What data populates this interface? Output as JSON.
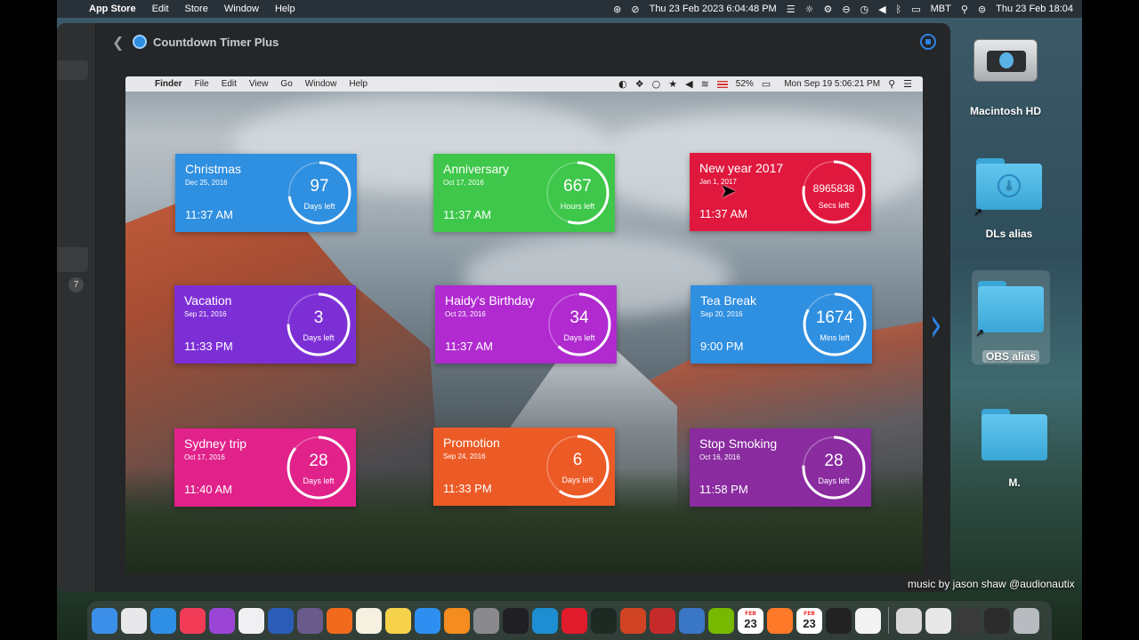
{
  "host_menubar": {
    "apple": "",
    "app": "App Store",
    "menus": [
      "Edit",
      "Store",
      "Window",
      "Help"
    ],
    "datetime": "Thu 23 Feb 2023  6:04:48 PM",
    "keyboard": "MBT",
    "clock": "Thu 23 Feb  18:04",
    "status_icons": [
      "screen-share-icon",
      "accessibility-icon",
      "menu-extra-icon",
      "brightness-icon",
      "shortcut-icon",
      "focus-icon",
      "time-machine-icon",
      "volume-icon",
      "bluetooth-icon",
      "battery-icon",
      "search-icon",
      "control-center-icon"
    ]
  },
  "app": {
    "title": "Countdown Timer Plus",
    "sidebar_badge": "7"
  },
  "inner_menubar": {
    "app": "Finder",
    "menus": [
      "File",
      "Edit",
      "View",
      "Go",
      "Window",
      "Help"
    ],
    "battery": "52%",
    "datetime": "Mon Sep 19  5:06:21 PM"
  },
  "cards": [
    {
      "title": "Christmas",
      "date": "Dec 25, 2016",
      "time": "11:37 AM",
      "value": "97",
      "unit": "Days left",
      "color": "#2f8fe0",
      "progress": 0.73
    },
    {
      "title": "Anniversary",
      "date": "Oct 17, 2016",
      "time": "11:37 AM",
      "value": "667",
      "unit": "Hours left",
      "color": "#3ec74a",
      "progress": 0.55
    },
    {
      "title": "New year 2017",
      "date": "Jan 1, 2017",
      "time": "11:37 AM",
      "value": "8965838",
      "unit": "Secs left",
      "color": "#e0183e",
      "progress": 0.78
    },
    {
      "title": "Vacation",
      "date": "Sep 21, 2016",
      "time": "11:33 PM",
      "value": "3",
      "unit": "Days left",
      "color": "#7d2fd6",
      "progress": 0.75
    },
    {
      "title": "Haidy's Birthday",
      "date": "Oct 23, 2016",
      "time": "11:37 AM",
      "value": "34",
      "unit": "Days left",
      "color": "#b02ad0",
      "progress": 0.62
    },
    {
      "title": "Tea Break",
      "date": "Sep 20, 2016",
      "time": "9:00 PM",
      "value": "1674",
      "unit": "Mins left",
      "color": "#2f8fe0",
      "progress": 0.83
    },
    {
      "title": "Sydney trip",
      "date": "Oct 17, 2016",
      "time": "11:40 AM",
      "value": "28",
      "unit": "Days left",
      "color": "#e0228a",
      "progress": 0.86
    },
    {
      "title": "Promotion",
      "date": "Sep 24, 2016",
      "time": "11:33 PM",
      "value": "6",
      "unit": "Days left",
      "color": "#ec5a26",
      "progress": 0.6
    },
    {
      "title": "Stop Smoking",
      "date": "Oct 16, 2016",
      "time": "11:58 PM",
      "value": "28",
      "unit": "Days left",
      "color": "#8a2ba0",
      "progress": 0.76
    }
  ],
  "desktop": {
    "items": [
      "Macintosh HD",
      "DLs alias",
      "OBS alias",
      "M."
    ]
  },
  "dock": {
    "calendar_month_1": "FEB",
    "calendar_day_1": "23",
    "calendar_month_2": "FEB",
    "calendar_day_2": "23",
    "apps": [
      {
        "name": "finder",
        "color": "#3b8fe8"
      },
      {
        "name": "launchpad",
        "color": "#e8e8ea"
      },
      {
        "name": "safari",
        "color": "#2f8fe5"
      },
      {
        "name": "music",
        "color": "#f23c57"
      },
      {
        "name": "podcasts",
        "color": "#9b45d6"
      },
      {
        "name": "photos",
        "color": "#f0f0f2"
      },
      {
        "name": "word",
        "color": "#2b5cb8"
      },
      {
        "name": "macos-utility",
        "color": "#6a5a8c"
      },
      {
        "name": "firefox",
        "color": "#f26a1b"
      },
      {
        "name": "textedit",
        "color": "#f5f0e0"
      },
      {
        "name": "notes",
        "color": "#f6d24a"
      },
      {
        "name": "app-store",
        "color": "#2f8ff0"
      },
      {
        "name": "books",
        "color": "#f58c1f"
      },
      {
        "name": "system-preferences",
        "color": "#8a8a8e"
      },
      {
        "name": "obs",
        "color": "#1f1f24"
      },
      {
        "name": "edge",
        "color": "#1d8ed1"
      },
      {
        "name": "opera",
        "color": "#e21b2c"
      },
      {
        "name": "activity-monitor",
        "color": "#1d2a24"
      },
      {
        "name": "powerpoint",
        "color": "#d04423"
      },
      {
        "name": "photo-booth",
        "color": "#c62b2b"
      },
      {
        "name": "stats",
        "color": "#3a76c6"
      },
      {
        "name": "nvidia",
        "color": "#76b900"
      },
      {
        "name": "calendar",
        "color": "#ffffff"
      },
      {
        "name": "sublime",
        "color": "#ff7a28"
      },
      {
        "name": "calendar-2",
        "color": "#ffffff"
      },
      {
        "name": "shortcuts",
        "color": "#222222"
      },
      {
        "name": "shortcuts-app",
        "color": "#f3f3f3"
      },
      {
        "name": "music-file",
        "color": "#d8d8d8"
      },
      {
        "name": "finder-window",
        "color": "#e8e8e8"
      },
      {
        "name": "window-thumb-1",
        "color": "#3a3a3a"
      },
      {
        "name": "window-thumb-2",
        "color": "#2c2c2c"
      },
      {
        "name": "trash",
        "color": "#b8bcc0"
      }
    ]
  },
  "caption": "music by jason shaw @audionautix"
}
